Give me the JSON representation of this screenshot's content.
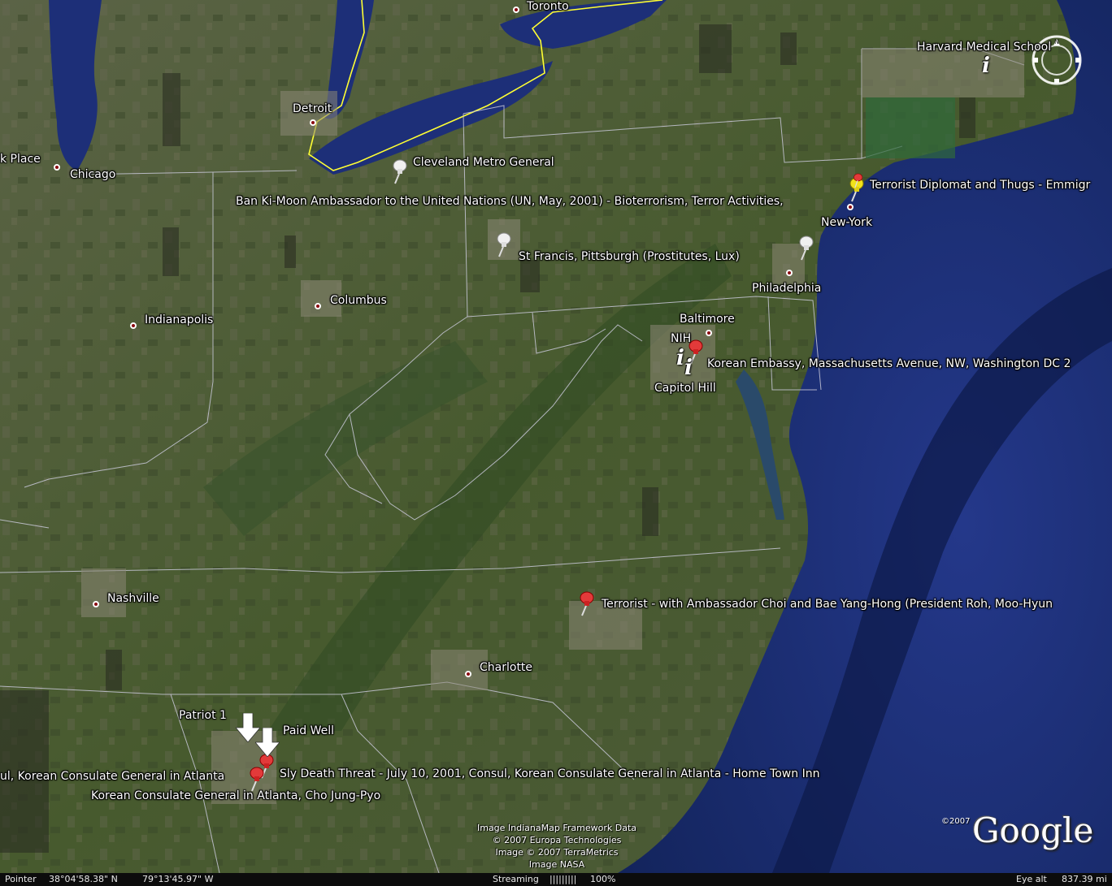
{
  "places": {
    "toronto": "Toronto",
    "detroit": "Detroit",
    "chicago": "Chicago",
    "park_place": "k Place",
    "cleveland": "Cleveland Metro General",
    "ban_ki_moon": "Ban Ki-Moon Ambassador to the United Nations (UN, May, 2001) - Bioterrorism, Terror Activities,",
    "terrorist_diplomat": "Terrorist Diplomat and Thugs - Emmigr",
    "new_york": "New-York",
    "harvard": "Harvard Medical School",
    "st_francis": "St Francis, Pittsburgh (Prostitutes, Lux)",
    "philadelphia": "Philadelphia",
    "columbus": "Columbus",
    "indianapolis": "Indianapolis",
    "baltimore": "Baltimore",
    "nih": "NIH",
    "korean_embassy": "Korean Embassy, Massachusetts Avenue, NW, Washington DC 2",
    "capitol_hill": "Capitol Hill",
    "nashville": "Nashville",
    "terrorist_ambassador": "Terrorist - with Ambassador Choi and Bae Yang-Hong (President Roh, Moo-Hyun",
    "charlotte": "Charlotte",
    "patriot1": "Patriot 1",
    "paid_well": "Paid Well",
    "sly_death": "Sly Death Threat - July 10, 2001, Consul, Korean Consulate General in Atlanta - Home Town Inn",
    "consul_atlanta": "ul, Korean Consulate General in Atlanta",
    "korean_consulate_cho": "Korean Consulate General in Atlanta, Cho Jung-Pyo"
  },
  "credits": {
    "line1": "Image IndianaMap Framework Data",
    "line2": "© 2007 Europa Technologies",
    "line3": "Image © 2007 TerraMetrics",
    "line4": "Image NASA"
  },
  "logo": {
    "text": "Google",
    "copyright": "©2007"
  },
  "compass": {
    "north": "N"
  },
  "status": {
    "pointer_label": "Pointer",
    "lat": "38°04'58.38\" N",
    "lon": "79°13'45.97\" W",
    "streaming_label": "Streaming",
    "streaming_bar": "|||||||||",
    "streaming_pct": "100%",
    "eye_alt_label": "Eye alt",
    "eye_alt_value": "837.39 mi"
  },
  "colors": {
    "ocean": "#1a2f6e",
    "lake": "#1d2f78",
    "land": "#4a5a32",
    "border": "#c8c8d8",
    "intl_border": "#ffff33",
    "city_dot": "#8a0a10",
    "pin_red": "#e23a3a",
    "pin_yellow": "#f2e21a",
    "pin_white": "#f0f0f0"
  }
}
